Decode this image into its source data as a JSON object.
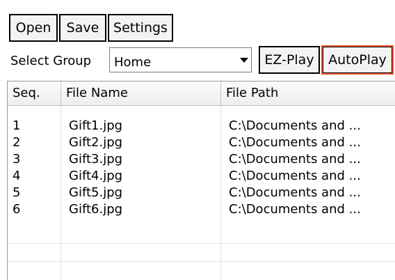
{
  "toolbar": {
    "open_label": "Open",
    "save_label": "Save",
    "settings_label": "Settings"
  },
  "group": {
    "label": "Select Group",
    "selected": "Home"
  },
  "play": {
    "ezplay_label": "EZ-Play",
    "autoplay_label": "AutoPlay"
  },
  "table": {
    "columns": [
      "Seq.",
      "File Name",
      "File Path"
    ],
    "rows": [
      {
        "seq": "1",
        "name": "Gift1.jpg",
        "path": "C:\\Documents and ..."
      },
      {
        "seq": "2",
        "name": "Gift2.jpg",
        "path": "C:\\Documents and ..."
      },
      {
        "seq": "3",
        "name": "Gift3.jpg",
        "path": "C:\\Documents and ..."
      },
      {
        "seq": "4",
        "name": "Gift4.jpg",
        "path": "C:\\Documents and ..."
      },
      {
        "seq": "5",
        "name": "Gift5.jpg",
        "path": "C:\\Documents and ..."
      },
      {
        "seq": "6",
        "name": "Gift6.jpg",
        "path": "C:\\Documents and ..."
      }
    ]
  },
  "colors": {
    "highlight_border": "#e8542f",
    "button_border": "#000000",
    "grid_line": "#dedede"
  },
  "icons": {
    "dropdown": "chevron-down-icon"
  }
}
